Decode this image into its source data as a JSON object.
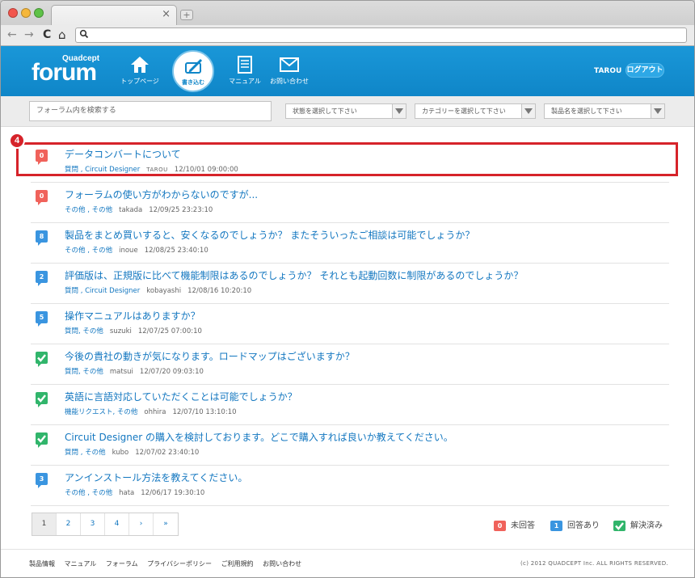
{
  "browser": {
    "tab_close": "×",
    "newtab": "+",
    "back": "←",
    "forward": "→",
    "reload": "C",
    "home": "⌂",
    "address": ""
  },
  "header": {
    "logo_small": "Quadcept",
    "logo_big": "forum",
    "nav": {
      "top": "トップページ",
      "post": "書き込む",
      "manual": "マニュアル",
      "contact": "お問い合わせ"
    },
    "user": "TAROU",
    "logout": "ログアウト"
  },
  "filters": {
    "search_placeholder": "フォーラム内を検索する",
    "status": "状態を選択して下さい",
    "category": "カテゴリーを選択して下さい",
    "product": "製品名を選択して下さい"
  },
  "annotation": {
    "step": "4"
  },
  "threads": [
    {
      "count": "0",
      "status": "unanswered",
      "title": "データコンバートについて",
      "cats": "質問 , Circuit Designer",
      "author": "TAROU",
      "date": "12/10/01 09:00:00"
    },
    {
      "count": "0",
      "status": "unanswered",
      "title": "フォーラムの使い方がわからないのですが...",
      "cats": "その他 , その他",
      "author": "takada",
      "date": "12/09/25 23:23:10"
    },
    {
      "count": "8",
      "status": "answered",
      "title": "製品をまとめ買いすると、安くなるのでしょうか？ またそういったご相談は可能でしょうか？",
      "cats": "その他 , その他",
      "author": "inoue",
      "date": "12/08/25 23:40:10"
    },
    {
      "count": "2",
      "status": "answered",
      "title": "評価版は、正規版に比べて機能制限はあるのでしょうか？ それとも起動回数に制限があるのでしょうか？",
      "cats": "質問 , Circuit Designer",
      "author": "kobayashi",
      "date": "12/08/16 10:20:10"
    },
    {
      "count": "5",
      "status": "answered",
      "title": "操作マニュアルはありますか？",
      "cats": "質問, その他",
      "author": "suzuki",
      "date": "12/07/25 07:00:10"
    },
    {
      "count": "",
      "status": "resolved",
      "title": "今後の貴社の動きが気になります。ロードマップはございますか？",
      "cats": "質問, その他",
      "author": "matsui",
      "date": "12/07/20 09:03:10"
    },
    {
      "count": "",
      "status": "resolved",
      "title": "英語に言語対応していただくことは可能でしょうか？",
      "cats": "機能リクエスト, その他",
      "author": "ohhira",
      "date": "12/07/10 13:10:10"
    },
    {
      "count": "",
      "status": "resolved",
      "title": "Circuit Designer の購入を検討しております。どこで購入すれば良いか教えてください。",
      "cats": "質問 , その他",
      "author": "kubo",
      "date": "12/07/02 23:40:10"
    },
    {
      "count": "3",
      "status": "answered",
      "title": "アンインストール方法を教えてください。",
      "cats": "その他 , その他",
      "author": "hata",
      "date": "12/06/17 19:30:10"
    }
  ],
  "pagination": [
    "1",
    "2",
    "3",
    "4",
    "›",
    "»"
  ],
  "legend": {
    "unanswered_badge": "0",
    "unanswered": "未回答",
    "answered_badge": "1",
    "answered": "回答あり",
    "resolved": "解決済み"
  },
  "footer": {
    "links": [
      "製品情報",
      "マニュアル",
      "フォーラム",
      "プライバシーポリシー",
      "ご利用規約",
      "お問い合わせ"
    ],
    "copyright": "(c) 2012 QUADCEPT Inc. ALL RIGHTS RESERVED."
  },
  "colors": {
    "brand_blue": "#1a97d8",
    "unanswered_red": "#f0625b",
    "answered_blue": "#3a95e0",
    "resolved_green": "#31b56b",
    "highlight_red": "#d6232a",
    "link_blue": "#1377c0"
  }
}
